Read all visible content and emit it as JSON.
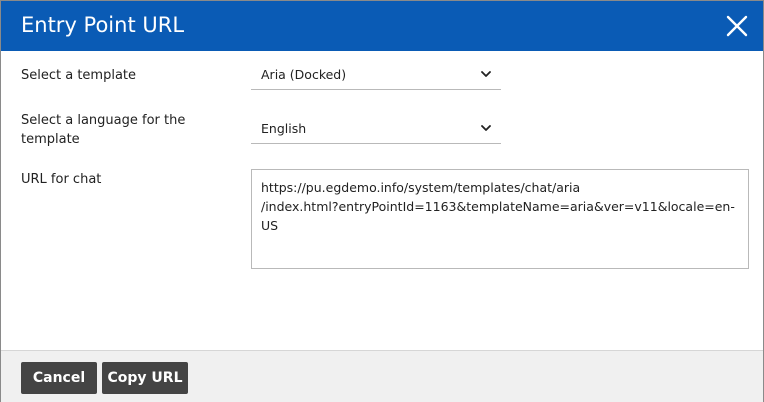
{
  "dialog": {
    "title": "Entry Point URL",
    "close_icon": "close-icon"
  },
  "form": {
    "template": {
      "label": "Select a template",
      "selected": "Aria (Docked)"
    },
    "language": {
      "label": "Select a language for the template",
      "selected": "English"
    },
    "url": {
      "label": "URL for chat",
      "value": "https://pu.egdemo.info/system/templates/chat/aria\n/index.html?entryPointId=1163&templateName=aria&ver=v11&locale=en-US"
    }
  },
  "footer": {
    "cancel_label": "Cancel",
    "copy_label": "Copy URL"
  },
  "colors": {
    "header": "#0a5bb5",
    "button": "#444444"
  }
}
